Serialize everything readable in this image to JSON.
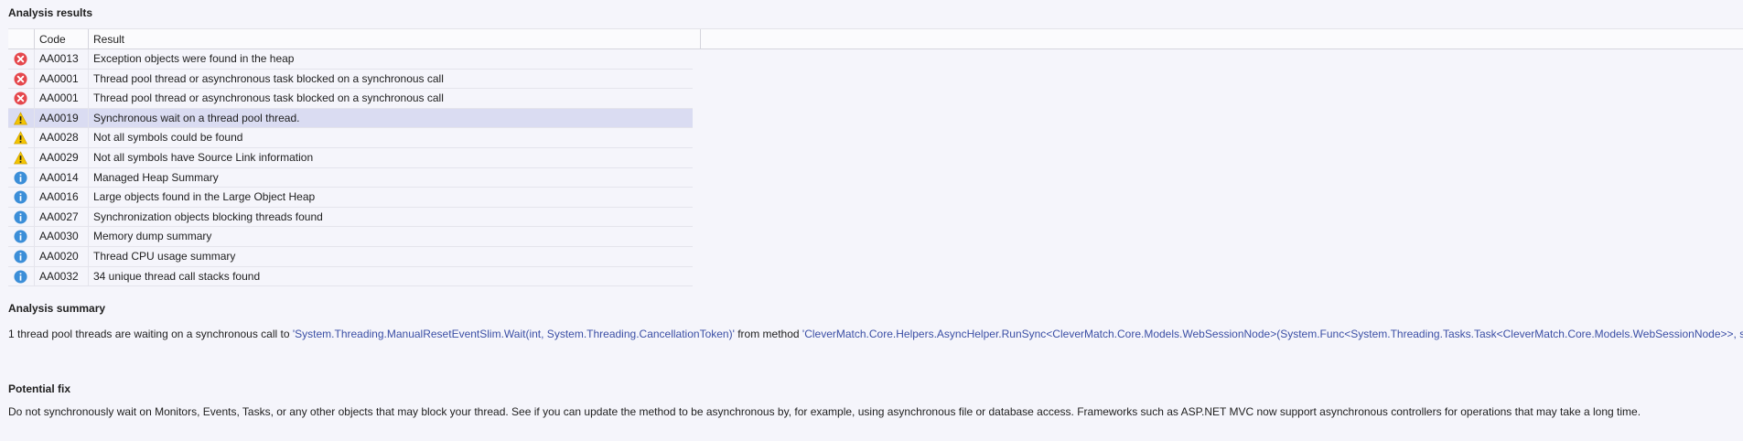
{
  "sections": {
    "results_title": "Analysis results",
    "summary_title": "Analysis summary",
    "fix_title": "Potential fix"
  },
  "table": {
    "columns": [
      "",
      "Code",
      "Result"
    ],
    "rows": [
      {
        "icon": "error-icon",
        "code": "AA0013",
        "result": "Exception objects were found in the heap"
      },
      {
        "icon": "error-icon",
        "code": "AA0001",
        "result": "Thread pool thread or asynchronous task blocked on a synchronous call"
      },
      {
        "icon": "error-icon",
        "code": "AA0001",
        "result": "Thread pool thread or asynchronous task blocked on a synchronous call"
      },
      {
        "icon": "warning-icon",
        "code": "AA0019",
        "result": "Synchronous wait on a thread pool thread.",
        "selected": true
      },
      {
        "icon": "warning-icon",
        "code": "AA0028",
        "result": "Not all symbols could be found"
      },
      {
        "icon": "warning-icon",
        "code": "AA0029",
        "result": "Not all symbols have Source Link information"
      },
      {
        "icon": "info-icon",
        "code": "AA0014",
        "result": "Managed Heap Summary"
      },
      {
        "icon": "info-icon",
        "code": "AA0016",
        "result": "Large objects found in the Large Object Heap"
      },
      {
        "icon": "info-icon",
        "code": "AA0027",
        "result": "Synchronization objects blocking threads found"
      },
      {
        "icon": "info-icon",
        "code": "AA0030",
        "result": "Memory dump summary"
      },
      {
        "icon": "info-icon",
        "code": "AA0020",
        "result": "Thread CPU usage summary"
      },
      {
        "icon": "info-icon",
        "code": "AA0032",
        "result": "34 unique thread call stacks found"
      }
    ]
  },
  "summary": {
    "prefix": "1 thread pool threads are waiting on a synchronous call to ",
    "call_link": "'System.Threading.ManualResetEventSlim.Wait(int, System.Threading.CancellationToken)'",
    "middle": " from method ",
    "method_link": "'CleverMatch.Core.Helpers.AsyncHelper.RunSync<CleverMatch.Core.Models.WebSessionNode>(System.Func<System.Threading.Tasks.Task<CleverMatch.Core.Models.WebSessionNode>>, string)'",
    "suffix": "."
  },
  "fix": {
    "text": "Do not synchronously wait on Monitors, Events, Tasks, or any other objects that may block your thread. See if you can update the method to be asynchronous by, for example, using asynchronous file or database access. Frameworks such as ASP.NET MVC now support asynchronous controllers for operations that may take a long time."
  },
  "colors": {
    "error": "#e5484d",
    "warning": "#f3c400",
    "info": "#3b8ed8",
    "link": "#3b4fa5",
    "selected_row": "#dadcf2"
  }
}
